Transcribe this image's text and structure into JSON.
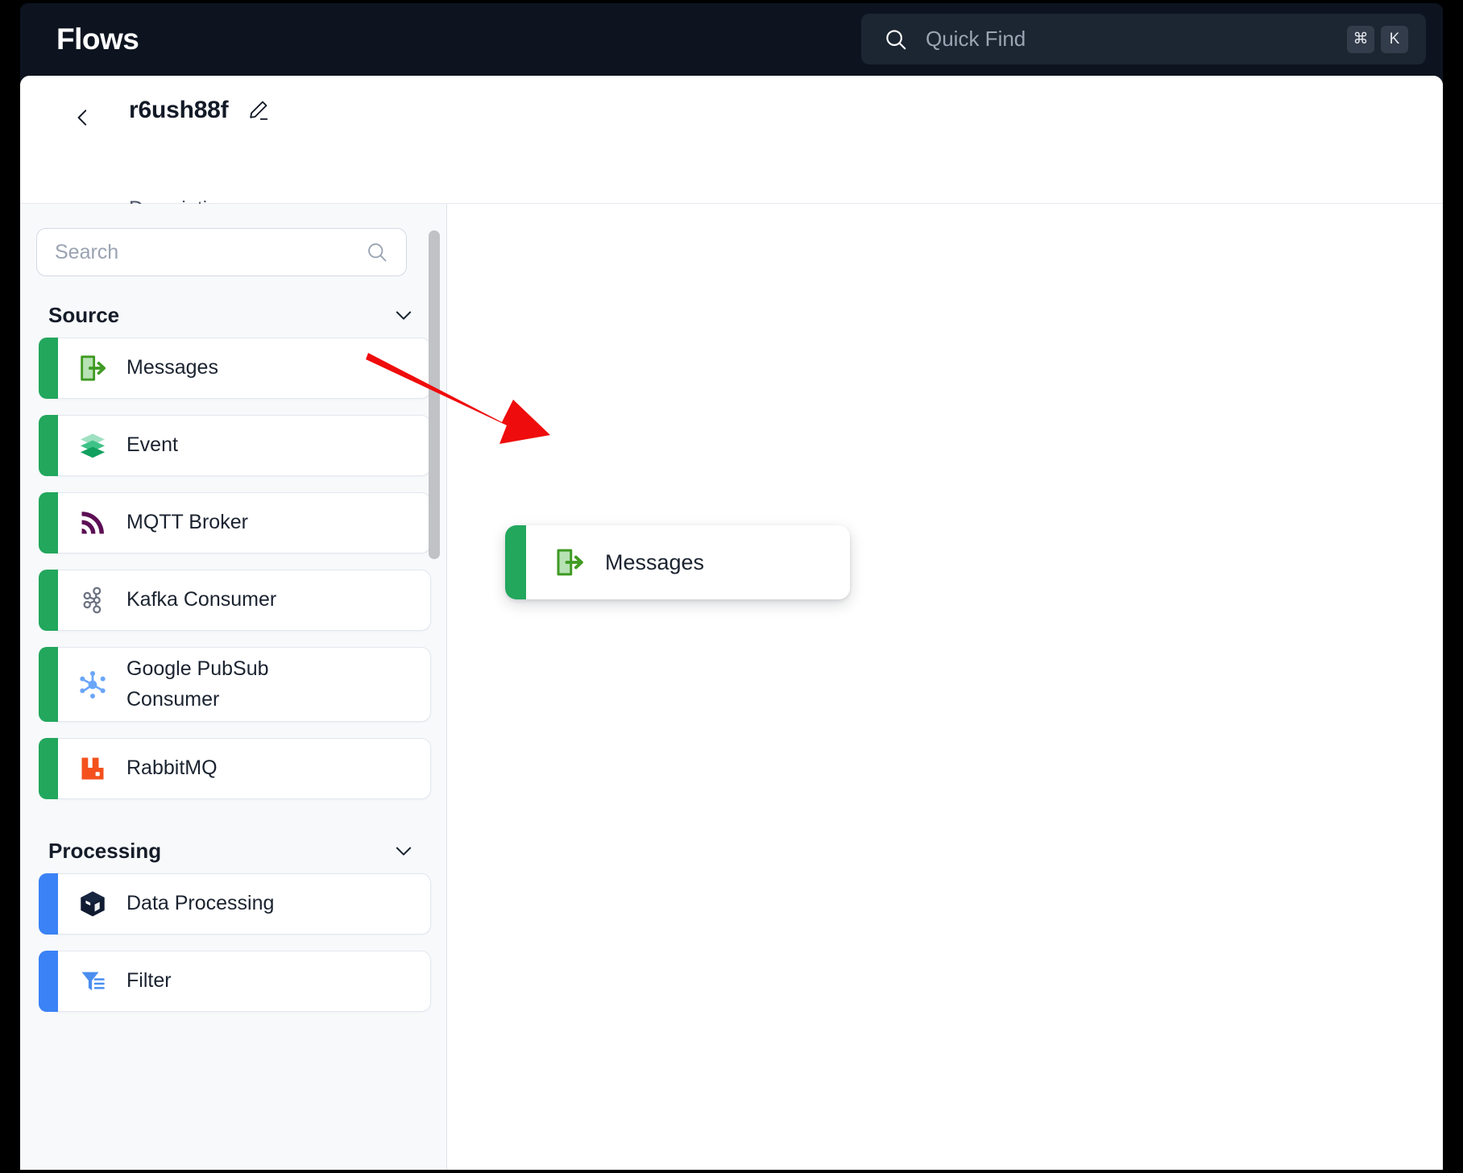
{
  "app": {
    "brand": "Flows"
  },
  "quick_find": {
    "placeholder": "Quick Find",
    "key_modifier": "⌘",
    "key_letter": "K",
    "icon": "search-icon"
  },
  "flow_header": {
    "back_icon": "chevron-left-icon",
    "title": "r6ush88f",
    "edit_icon": "pencil-icon",
    "description": "Description"
  },
  "sidebar": {
    "search": {
      "placeholder": "Search",
      "value": "",
      "icon": "search-icon"
    },
    "sections": [
      {
        "title": "Source",
        "accent": "#22a75d",
        "chevron": "chevron-down-icon",
        "items": [
          {
            "label": "Messages",
            "icon": "messages-export-icon"
          },
          {
            "label": "Event",
            "icon": "layers-icon"
          },
          {
            "label": "MQTT Broker",
            "icon": "mqtt-signal-icon"
          },
          {
            "label": "Kafka Consumer",
            "icon": "kafka-nodes-icon"
          },
          {
            "label": "Google PubSub Consumer",
            "icon": "google-pubsub-icon"
          },
          {
            "label": "RabbitMQ",
            "icon": "rabbitmq-icon"
          }
        ]
      },
      {
        "title": "Processing",
        "accent": "#3b82f6",
        "chevron": "chevron-down-icon",
        "items": [
          {
            "label": "Data Processing",
            "icon": "cube-icon"
          },
          {
            "label": "Filter",
            "icon": "funnel-icon"
          }
        ]
      }
    ],
    "scrollbar": {
      "name": "sidebar-scrollbar"
    }
  },
  "canvas": {
    "nodes": [
      {
        "label": "Messages",
        "icon": "messages-export-icon",
        "accent": "#22a75d"
      }
    ],
    "annotation_arrow": {
      "color": "#ef0c0c",
      "from": "Messages palette item",
      "to": "Messages canvas node"
    }
  },
  "colors": {
    "topbar_bg": "#0d1420",
    "source_accent": "#22a75d",
    "processing_accent": "#3b82f6",
    "annotation_red": "#ef0c0c"
  }
}
